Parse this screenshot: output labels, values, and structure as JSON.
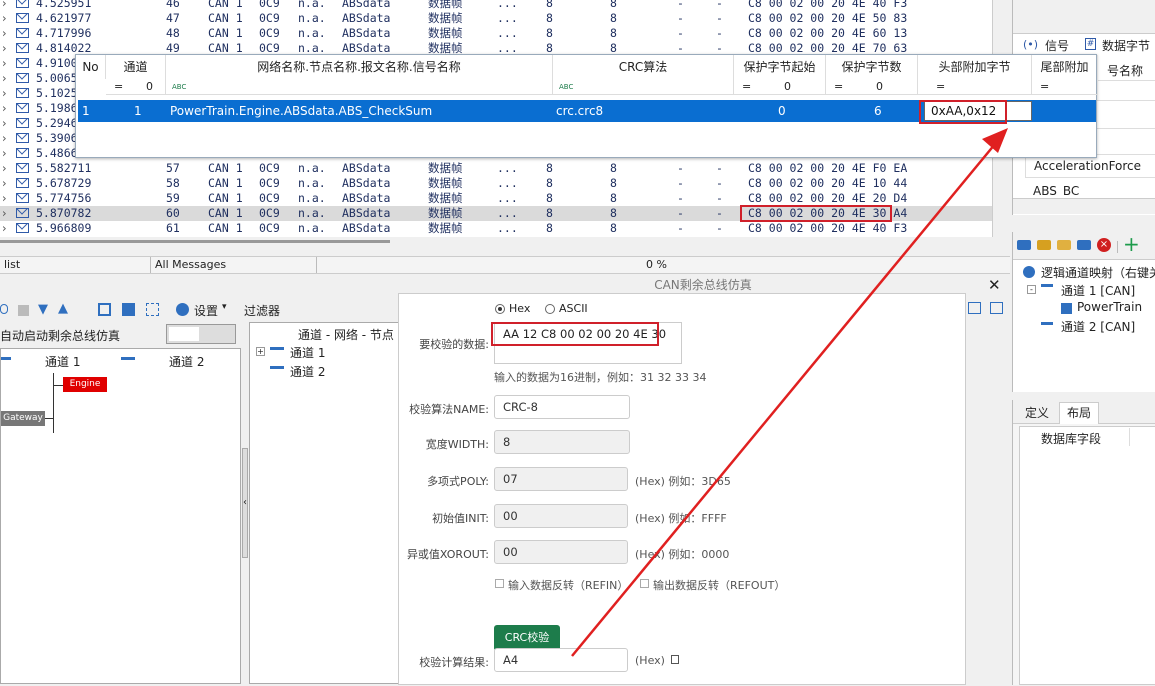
{
  "trace_rows": [
    {
      "time": "4.525951",
      "idx": "46",
      "type": "CAN 1",
      "id": "0C9",
      "node": "n.a.",
      "msg": "ABSdata",
      "kind": "数据帧",
      "dots": "...",
      "dlc": "8",
      "len": "8",
      "a": "-",
      "b": "-",
      "data": "C8 00 02 00 20 4E 40 F3"
    },
    {
      "time": "4.621977",
      "idx": "47",
      "type": "CAN 1",
      "id": "0C9",
      "node": "n.a.",
      "msg": "ABSdata",
      "kind": "数据帧",
      "dots": "...",
      "dlc": "8",
      "len": "8",
      "a": "-",
      "b": "-",
      "data": "C8 00 02 00 20 4E 50 83"
    },
    {
      "time": "4.717996",
      "idx": "48",
      "type": "CAN 1",
      "id": "0C9",
      "node": "n.a.",
      "msg": "ABSdata",
      "kind": "数据帧",
      "dots": "...",
      "dlc": "8",
      "len": "8",
      "a": "-",
      "b": "-",
      "data": "C8 00 02 00 20 4E 60 13"
    },
    {
      "time": "4.814022",
      "idx": "49",
      "type": "CAN 1",
      "id": "0C9",
      "node": "n.a.",
      "msg": "ABSdata",
      "kind": "数据帧",
      "dots": "...",
      "dlc": "8",
      "len": "8",
      "a": "-",
      "b": "-",
      "data": "C8 00 02 00 20 4E 70 63"
    },
    {
      "time": "4.9100",
      "idx": "",
      "type": "",
      "id": "",
      "node": "",
      "msg": "",
      "kind": "",
      "dots": "",
      "dlc": "",
      "len": "",
      "a": "",
      "b": "",
      "data": ""
    },
    {
      "time": "5.0065",
      "idx": "",
      "type": "",
      "id": "",
      "node": "",
      "msg": "",
      "kind": "",
      "dots": "",
      "dlc": "",
      "len": "",
      "a": "",
      "b": "",
      "data": ""
    },
    {
      "time": "5.1025",
      "idx": "",
      "type": "",
      "id": "",
      "node": "",
      "msg": "",
      "kind": "",
      "dots": "",
      "dlc": "",
      "len": "",
      "a": "",
      "b": "",
      "data": ""
    },
    {
      "time": "5.1986",
      "idx": "",
      "type": "",
      "id": "",
      "node": "",
      "msg": "",
      "kind": "",
      "dots": "",
      "dlc": "",
      "len": "",
      "a": "",
      "b": "",
      "data": ""
    },
    {
      "time": "5.2946",
      "idx": "",
      "type": "",
      "id": "",
      "node": "",
      "msg": "",
      "kind": "",
      "dots": "",
      "dlc": "",
      "len": "",
      "a": "",
      "b": "",
      "data": ""
    },
    {
      "time": "5.3906",
      "idx": "",
      "type": "",
      "id": "",
      "node": "",
      "msg": "",
      "kind": "",
      "dots": "",
      "dlc": "",
      "len": "",
      "a": "",
      "b": "",
      "data": ""
    },
    {
      "time": "5.4866",
      "idx": "",
      "type": "",
      "id": "",
      "node": "",
      "msg": "",
      "kind": "",
      "dots": "",
      "dlc": "",
      "len": "",
      "a": "",
      "b": "",
      "data": ""
    },
    {
      "time": "5.582711",
      "idx": "57",
      "type": "CAN 1",
      "id": "0C9",
      "node": "n.a.",
      "msg": "ABSdata",
      "kind": "数据帧",
      "dots": "...",
      "dlc": "8",
      "len": "8",
      "a": "-",
      "b": "-",
      "data": "C8 00 02 00 20 4E F0 EA"
    },
    {
      "time": "5.678729",
      "idx": "58",
      "type": "CAN 1",
      "id": "0C9",
      "node": "n.a.",
      "msg": "ABSdata",
      "kind": "数据帧",
      "dots": "...",
      "dlc": "8",
      "len": "8",
      "a": "-",
      "b": "-",
      "data": "C8 00 02 00 20 4E 10 44"
    },
    {
      "time": "5.774756",
      "idx": "59",
      "type": "CAN 1",
      "id": "0C9",
      "node": "n.a.",
      "msg": "ABSdata",
      "kind": "数据帧",
      "dots": "...",
      "dlc": "8",
      "len": "8",
      "a": "-",
      "b": "-",
      "data": "C8 00 02 00 20 4E 20 D4"
    },
    {
      "time": "5.870782",
      "idx": "60",
      "type": "CAN 1",
      "id": "0C9",
      "node": "n.a.",
      "msg": "ABSdata",
      "kind": "数据帧",
      "dots": "...",
      "dlc": "8",
      "len": "8",
      "a": "-",
      "b": "-",
      "data": "C8 00 02 00 20 4E 30 A4"
    },
    {
      "time": "5.966809",
      "idx": "61",
      "type": "CAN 1",
      "id": "0C9",
      "node": "n.a.",
      "msg": "ABSdata",
      "kind": "数据帧",
      "dots": "...",
      "dlc": "8",
      "len": "8",
      "a": "-",
      "b": "-",
      "data": "C8 00 02 00 20 4E 40 F3"
    }
  ],
  "status": {
    "left": "list",
    "filter": "All Messages",
    "percent": "0 %"
  },
  "crc_grid": {
    "headers": [
      "No",
      "通道",
      "网络名称.节点名称.报文名称.信号名称",
      "CRC算法",
      "保护字节起始",
      "保护字节数",
      "头部附加字节",
      "尾部附加"
    ],
    "filters": {
      "channel_op": "=",
      "channel_val": "0",
      "name_op": "ABC",
      "algo_op": "ABC",
      "start_op": "=",
      "start_val": "0",
      "count_op": "=",
      "count_val": "0",
      "head_op": "=",
      "tail_op": "="
    },
    "row": {
      "no": "1",
      "channel": "1",
      "name": "PowerTrain.Engine.ABSdata.ABS_CheckSum",
      "algo": "crc.crc8",
      "start": "0",
      "count": "6",
      "head": "0xAA,0x12"
    }
  },
  "right_top": {
    "tab_signal": "信号",
    "tab_bytes": "数据字节",
    "col_name": "号名称",
    "item1": "AccelerationForce",
    "item2": "ABS_BC"
  },
  "right_mid": {
    "root": "逻辑通道映射（右键关",
    "ch1": "通道 1 [CAN]",
    "pt": "PowerTrain",
    "ch2": "通道 2 [CAN]"
  },
  "right_bot": {
    "tab_def": "定义",
    "tab_layout": "布局",
    "field": "数据库字段"
  },
  "lower_left": {
    "settings": "设置",
    "filter_label": "过滤器",
    "autostart": "自动启动剩余总线仿真",
    "ch1": "通道 1",
    "ch2": "通道 2",
    "engine": "Engine",
    "gateway": "Gateway",
    "tree_header": "通道 - 网络 - 节点",
    "tree_ch1": "通道 1",
    "tree_ch2": "通道 2"
  },
  "dialog": {
    "title": "CAN剩余总线仿真",
    "mode_hex": "Hex",
    "mode_ascii": "ASCII",
    "data_label": "要校验的数据:",
    "data_value": "AA 12 C8 00 02 00 20 4E 30",
    "data_hint": "输入的数据为16进制，例如：31 32 33 34",
    "name_label": "校验算法NAME:",
    "name_value": "CRC-8",
    "width_label": "宽度WIDTH:",
    "width_value": "8",
    "poly_label": "多项式POLY:",
    "poly_value": "07",
    "poly_hint": "(Hex) 例如：3D65",
    "init_label": "初始值INIT:",
    "init_value": "00",
    "init_hint": "(Hex) 例如：FFFF",
    "xor_label": "异或值XOROUT:",
    "xor_value": "00",
    "xor_hint": "(Hex) 例如：0000",
    "refin": "输入数据反转（REFIN）",
    "refout": "输出数据反转（REFOUT）",
    "button": "CRC校验",
    "result_label": "校验计算结果:",
    "result_value": "A4",
    "result_hint": "(Hex)"
  },
  "colors": {
    "highlight": "#d0202a",
    "selection": "#0a6ed1",
    "button": "#1d7c4b"
  }
}
